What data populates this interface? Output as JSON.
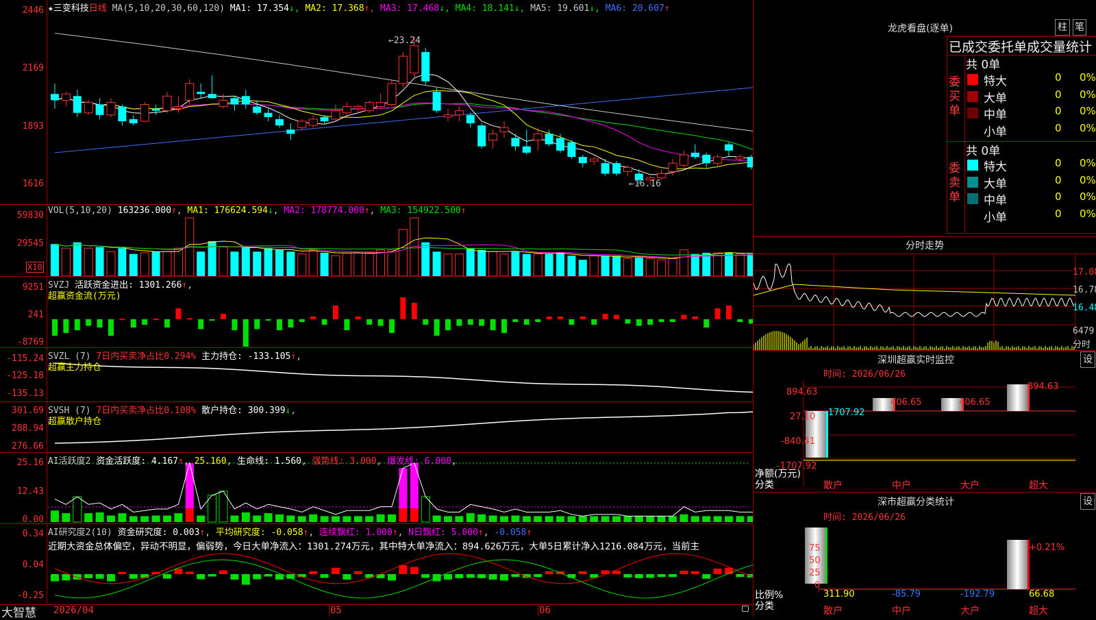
{
  "main": {
    "stock_name": "三变科技",
    "period": "日线",
    "ma_label": "MA(5,10,20,30,60,120)",
    "ma_values": [
      {
        "label": "MA1:",
        "value": "17.354",
        "arrow": "↓",
        "color": "#ffffff"
      },
      {
        "label": "MA2:",
        "value": "17.368",
        "arrow": "↑",
        "color": "#ffff00"
      },
      {
        "label": "MA3:",
        "value": "17.468",
        "arrow": "↓",
        "color": "#ff00ff"
      },
      {
        "label": "MA4:",
        "value": "18.141",
        "arrow": "↓",
        "color": "#00e000"
      },
      {
        "label": "MA5:",
        "value": "19.601",
        "arrow": "↓",
        "color": "#c8c8c8"
      },
      {
        "label": "MA6:",
        "value": "20.607",
        "arrow": "↑",
        "color": "#3f6fff"
      }
    ],
    "y_ticks": [
      "2446",
      "2169",
      "1893",
      "1616"
    ],
    "high_label": "23.24",
    "low_label": "16.16",
    "candles": [
      [
        20.5,
        21.0,
        19.8,
        20.2
      ],
      [
        20.2,
        20.6,
        19.9,
        20.5
      ],
      [
        20.4,
        20.7,
        19.4,
        19.6
      ],
      [
        19.6,
        20.2,
        19.5,
        20.1
      ],
      [
        20.0,
        20.3,
        19.3,
        19.5
      ],
      [
        19.5,
        20.3,
        19.4,
        20.1
      ],
      [
        19.9,
        20.0,
        19.0,
        19.2
      ],
      [
        19.3,
        19.5,
        19.0,
        19.1
      ],
      [
        19.2,
        20.1,
        19.2,
        20.0
      ],
      [
        19.8,
        20.0,
        19.5,
        19.7
      ],
      [
        19.7,
        20.6,
        19.6,
        20.4
      ],
      [
        19.8,
        20.4,
        19.6,
        19.9
      ],
      [
        20.2,
        21.2,
        20.0,
        21.0
      ],
      [
        20.6,
        21.0,
        20.3,
        20.5
      ],
      [
        20.5,
        21.4,
        20.3,
        20.3
      ],
      [
        19.9,
        20.5,
        19.8,
        20.2
      ],
      [
        20.3,
        20.4,
        19.7,
        20.0
      ],
      [
        20.4,
        20.7,
        19.8,
        20.0
      ],
      [
        19.9,
        20.2,
        19.5,
        19.6
      ],
      [
        19.6,
        19.8,
        19.2,
        19.4
      ],
      [
        19.3,
        19.5,
        18.9,
        19.0
      ],
      [
        18.8,
        19.1,
        18.3,
        18.6
      ],
      [
        18.9,
        19.3,
        18.8,
        19.2
      ],
      [
        19.0,
        19.5,
        18.9,
        19.3
      ],
      [
        19.4,
        19.5,
        19.1,
        19.2
      ],
      [
        19.3,
        20.0,
        19.2,
        19.7
      ],
      [
        19.6,
        20.1,
        19.4,
        19.9
      ],
      [
        19.8,
        20.0,
        19.6,
        19.9
      ],
      [
        19.7,
        20.2,
        19.6,
        20.1
      ],
      [
        19.9,
        20.5,
        19.8,
        20.1
      ],
      [
        20.0,
        21.2,
        19.9,
        21.0
      ],
      [
        21.0,
        22.5,
        20.8,
        22.3
      ],
      [
        21.5,
        23.24,
        21.3,
        22.8
      ],
      [
        22.5,
        22.7,
        20.9,
        21.1
      ],
      [
        20.6,
        20.8,
        19.6,
        19.7
      ],
      [
        19.4,
        19.8,
        19.2,
        19.5
      ],
      [
        19.5,
        19.9,
        19.2,
        19.7
      ],
      [
        19.5,
        19.6,
        18.9,
        19.1
      ],
      [
        19.0,
        19.1,
        17.9,
        18.0
      ],
      [
        18.3,
        18.8,
        17.9,
        18.6
      ],
      [
        18.7,
        19.2,
        18.4,
        18.9
      ],
      [
        18.4,
        18.6,
        17.8,
        18.0
      ],
      [
        18.0,
        18.8,
        17.6,
        17.7
      ],
      [
        18.3,
        18.9,
        17.8,
        18.6
      ],
      [
        18.6,
        18.8,
        18.0,
        18.1
      ],
      [
        18.4,
        18.6,
        17.7,
        17.8
      ],
      [
        18.2,
        18.3,
        17.4,
        17.5
      ],
      [
        17.5,
        17.6,
        17.0,
        17.2
      ],
      [
        17.3,
        17.5,
        17.1,
        17.4
      ],
      [
        17.2,
        17.4,
        16.6,
        16.7
      ],
      [
        17.2,
        17.3,
        16.6,
        16.7
      ],
      [
        16.8,
        17.1,
        16.6,
        17.0
      ],
      [
        16.7,
        16.9,
        16.2,
        16.4
      ],
      [
        16.4,
        16.6,
        16.16,
        16.5
      ],
      [
        16.5,
        16.9,
        16.4,
        16.7
      ],
      [
        16.8,
        17.4,
        16.6,
        17.2
      ],
      [
        17.1,
        17.8,
        17.0,
        17.6
      ],
      [
        17.7,
        18.1,
        17.4,
        17.5
      ],
      [
        17.6,
        17.7,
        17.0,
        17.2
      ],
      [
        17.2,
        17.6,
        17.0,
        17.5
      ],
      [
        18.1,
        18.2,
        17.5,
        17.8
      ],
      [
        17.4,
        17.6,
        17.3,
        17.5
      ],
      [
        17.5,
        17.6,
        16.9,
        17.0
      ],
      [
        16.9,
        17.0,
        16.5,
        16.6
      ]
    ]
  },
  "vol": {
    "label": "VOL(5,10,20)",
    "value": "163236.000",
    "value_arrow": "↑",
    "ma1_label": "MA1:",
    "ma1": "176624.594",
    "ma1_arrow": "↓",
    "ma2_label": "MA2:",
    "ma2": "178774.000",
    "ma2_arrow": "↑",
    "ma3_label": "MA3:",
    "ma3": "154922.500",
    "ma3_arrow": "↑",
    "y_ticks": [
      "59830",
      "29545"
    ],
    "unit": "X10",
    "bars": [
      0.55,
      0.48,
      0.58,
      0.48,
      0.5,
      0.42,
      0.48,
      0.38,
      0.4,
      0.42,
      0.42,
      0.48,
      1.0,
      0.42,
      0.6,
      0.5,
      0.42,
      0.5,
      0.42,
      0.48,
      0.45,
      0.42,
      0.38,
      0.45,
      0.4,
      0.35,
      0.4,
      0.4,
      0.4,
      0.45,
      0.45,
      0.8,
      1.0,
      0.58,
      0.42,
      0.38,
      0.38,
      0.48,
      0.45,
      0.42,
      0.38,
      0.42,
      0.38,
      0.38,
      0.38,
      0.4,
      0.35,
      0.28,
      0.35,
      0.35,
      0.35,
      0.3,
      0.32,
      0.3,
      0.28,
      0.3,
      0.45,
      0.38,
      0.4,
      0.4,
      0.4,
      0.38,
      0.38,
      0.35
    ]
  },
  "svzj": {
    "name": "SVZJ",
    "label": "活跃资金进出:",
    "value": "1301.266",
    "arrow": "↑",
    "sub": "超赢资金流(万元)",
    "y_ticks": [
      "9251",
      "241",
      "-8769"
    ],
    "bars": [
      -0.3,
      -0.25,
      -0.2,
      -0.12,
      -0.15,
      -0.3,
      0.01,
      -0.15,
      -0.1,
      0.01,
      -0.15,
      0.2,
      0.02,
      -0.18,
      -0.02,
      0.1,
      -0.2,
      -0.5,
      -0.18,
      -0.02,
      -0.2,
      -0.15,
      -0.05,
      0.05,
      -0.1,
      0.25,
      -0.2,
      0.05,
      -0.1,
      -0.12,
      -0.25,
      0.4,
      0.3,
      -0.1,
      -0.3,
      -0.2,
      -0.12,
      -0.1,
      -0.12,
      -0.2,
      -0.25,
      -0.05,
      -0.1,
      -0.05,
      0.05,
      0.05,
      -0.1,
      0.05,
      -0.1,
      0.1,
      0.08,
      -0.08,
      -0.12,
      -0.1,
      -0.05,
      -0.05,
      0.08,
      0.05,
      -0.15,
      0.2,
      0.25,
      -0.05,
      -0.08,
      0.05
    ]
  },
  "svzl": {
    "name": "SVZL (7)",
    "label_red": "7日内买卖净占比0.294%",
    "label": "主力持仓:",
    "value": "-133.105",
    "arrow": "↑",
    "sub": "超赢主力持仓",
    "y_ticks": [
      "-115.24",
      "-125.18",
      "-135.13"
    ]
  },
  "svsh": {
    "name": "SVSH (7)",
    "label_red": "7日内买卖净占比0.108%",
    "label": "散户持仓:",
    "value": "300.399",
    "arrow": "↓",
    "sub": "超赢散户持仓",
    "y_ticks": [
      "301.69",
      "288.94",
      "276.66"
    ]
  },
  "ai1": {
    "name": "AI活跃度2",
    "label": "资金活跃度:",
    "value": "4.167",
    "arrow": "↑",
    "v2": "25.160",
    "life_label": "生命线:",
    "life": "1.560",
    "strong_label": "强势线:",
    "strong": "3.000",
    "burst_label": "爆发线:",
    "burst": "6.000",
    "y_ticks": [
      "25.16",
      "12.43",
      "0.00"
    ]
  },
  "ai2": {
    "name": "AI研究度2(10)",
    "label": "资金研究度:",
    "value": "0.003",
    "arrow": "↑",
    "avg_label": "平均研究度:",
    "avg": "-0.058",
    "avg_arrow": "↑",
    "red_label": "连续飘红:",
    "red": "1.000",
    "red_arrow": "↑",
    "n_label": "N日飘红:",
    "n": "5.000",
    "n_arrow": "↑",
    "last": "-0.058",
    "text": "近期大资金总体偏空，异动不明显，偏弱势，今日大单净流入：1301.274万元，其中特大单净流入：894.626万元，大单5日累计净入1216.084万元，当前主",
    "y_ticks": [
      "0.34",
      "0.04",
      "-0.25"
    ]
  },
  "xaxis": {
    "brand": "大智慧",
    "labels": [
      "2026/04",
      "05",
      "06"
    ]
  },
  "right": {
    "longhu_title": "龙虎看盘(逐单)",
    "btn1": "柱",
    "btn2": "笔",
    "stat_title": "已成交委托单成交量统计",
    "buy_side": "委买单",
    "sell_side": "委卖单",
    "total_buy": "共 0单",
    "total_sell": "共 0单",
    "rows": [
      {
        "label": "特大",
        "color": "#ff0000",
        "v": "0",
        "p": "0%"
      },
      {
        "label": "大单",
        "color": "#a00000",
        "v": "0",
        "p": "0%"
      },
      {
        "label": "中单",
        "color": "#700000",
        "v": "0",
        "p": "0%"
      },
      {
        "label": "小单",
        "color": "#000000",
        "v": "0",
        "p": "0%"
      }
    ],
    "sell_rows": [
      {
        "label": "特大",
        "color": "#00ffff",
        "v": "0",
        "p": "0%"
      },
      {
        "label": "大单",
        "color": "#009090",
        "v": "0",
        "p": "0%"
      },
      {
        "label": "中单",
        "color": "#007070",
        "v": "0",
        "p": "0%"
      },
      {
        "label": "小单",
        "color": "#000000",
        "v": "0",
        "p": "0%"
      }
    ],
    "intraday_title": "分时走势",
    "intraday_ticks": [
      "17.08",
      "16.78",
      "16.48"
    ],
    "intraday_vol": "6479",
    "intraday_unit": "分时",
    "monitor_title": "深圳超赢实时监控",
    "set": "设",
    "time_label": "时间: 2026/06/26",
    "monitor_ticks": [
      "894.63",
      "27.10",
      "-840.41",
      "-1707.92"
    ],
    "monitor_vals": [
      "-1707.92",
      "406.65",
      "406.65",
      "894.63"
    ],
    "net_label": "净额(万元)",
    "cat_label": "分类",
    "cats": [
      "散户",
      "中户",
      "大户",
      "超大"
    ],
    "class_title": "深市超赢分类统计",
    "class_ticks": [
      "75",
      "50",
      "25",
      "0"
    ],
    "ratio_label": "比例%",
    "class_vals": [
      "311.90",
      "-85.79",
      "-192.79",
      "66.68"
    ],
    "class_note": "+0.21%"
  }
}
